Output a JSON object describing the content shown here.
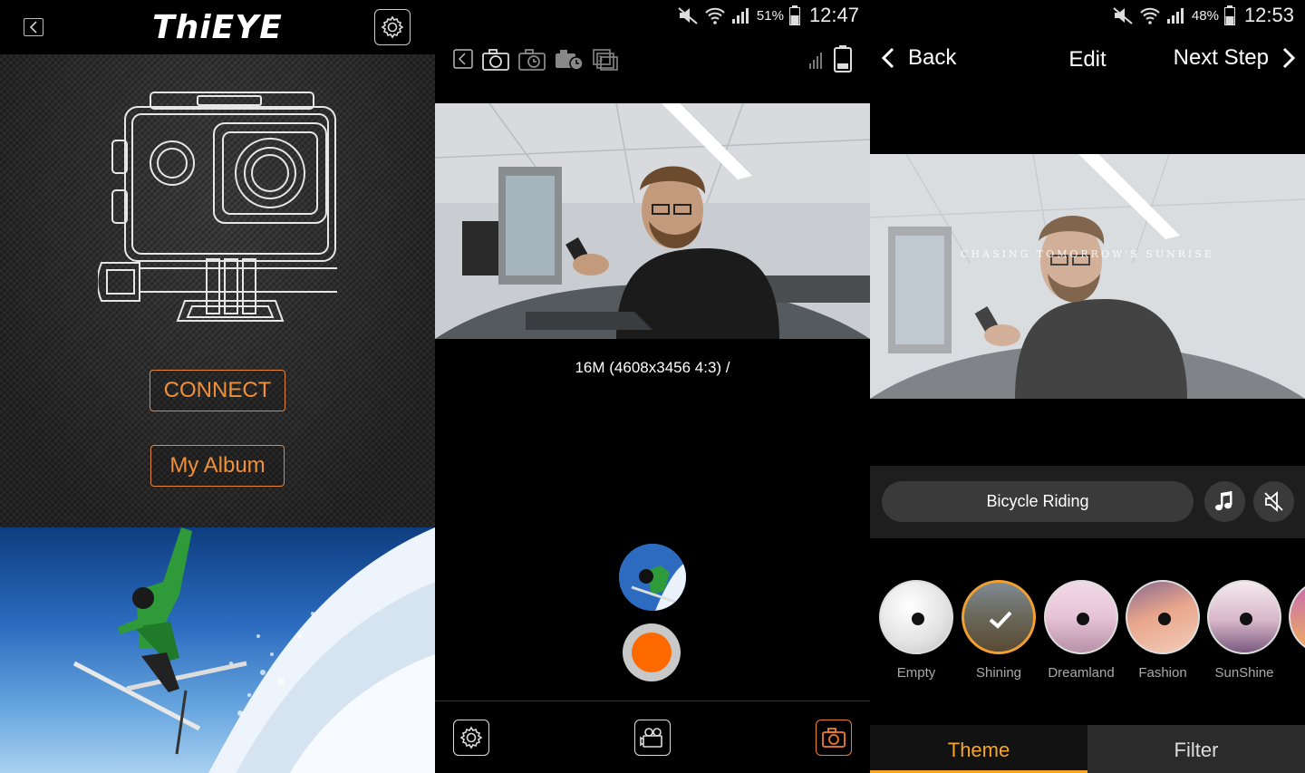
{
  "panel1": {
    "logo": "ThiEYE",
    "connect_label": "CONNECT",
    "album_label": "My Album"
  },
  "panel2": {
    "status": {
      "battery_pct": "51%",
      "time": "12:47"
    },
    "resolution_text": "16M (4608x3456 4:3) /"
  },
  "panel3": {
    "status": {
      "battery_pct": "48%",
      "time": "12:53"
    },
    "nav": {
      "back_label": "Back",
      "title": "Edit",
      "next_label": "Next Step"
    },
    "overlay_text": "CHASING TOMORROW'S SUNRISE",
    "music_title": "Bicycle Riding",
    "themes": [
      {
        "label": "Empty",
        "selected": false
      },
      {
        "label": "Shining",
        "selected": true
      },
      {
        "label": "Dreamland",
        "selected": false
      },
      {
        "label": "Fashion",
        "selected": false
      },
      {
        "label": "SunShine",
        "selected": false
      }
    ],
    "tabs": {
      "theme": "Theme",
      "filter": "Filter"
    }
  },
  "colors": {
    "accent_orange": "#f0903a",
    "shutter_orange": "#ff6a00",
    "tab_active": "#f5a623"
  }
}
